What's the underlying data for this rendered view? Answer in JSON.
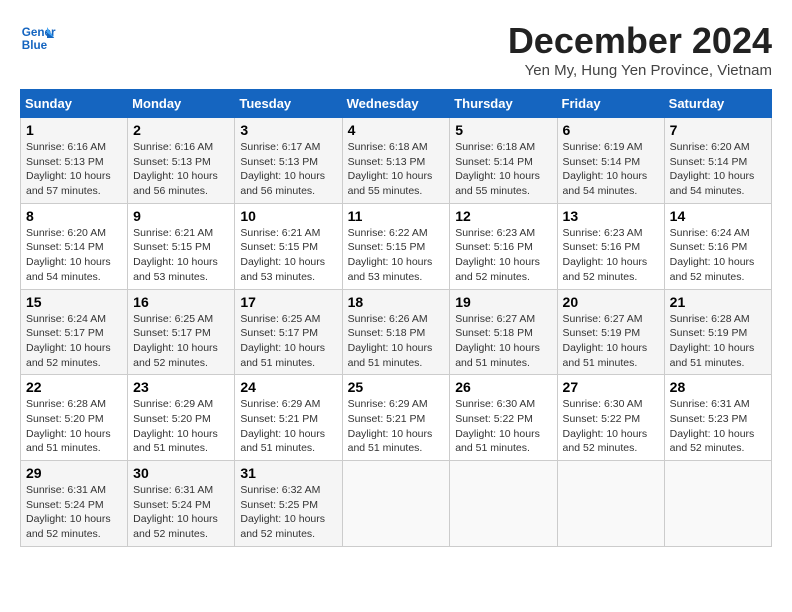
{
  "header": {
    "logo_line1": "General",
    "logo_line2": "Blue",
    "month_title": "December 2024",
    "location": "Yen My, Hung Yen Province, Vietnam"
  },
  "weekdays": [
    "Sunday",
    "Monday",
    "Tuesday",
    "Wednesday",
    "Thursday",
    "Friday",
    "Saturday"
  ],
  "weeks": [
    [
      {
        "day": "1",
        "sunrise": "6:16 AM",
        "sunset": "5:13 PM",
        "daylight": "10 hours and 57 minutes."
      },
      {
        "day": "2",
        "sunrise": "6:16 AM",
        "sunset": "5:13 PM",
        "daylight": "10 hours and 56 minutes."
      },
      {
        "day": "3",
        "sunrise": "6:17 AM",
        "sunset": "5:13 PM",
        "daylight": "10 hours and 56 minutes."
      },
      {
        "day": "4",
        "sunrise": "6:18 AM",
        "sunset": "5:13 PM",
        "daylight": "10 hours and 55 minutes."
      },
      {
        "day": "5",
        "sunrise": "6:18 AM",
        "sunset": "5:14 PM",
        "daylight": "10 hours and 55 minutes."
      },
      {
        "day": "6",
        "sunrise": "6:19 AM",
        "sunset": "5:14 PM",
        "daylight": "10 hours and 54 minutes."
      },
      {
        "day": "7",
        "sunrise": "6:20 AM",
        "sunset": "5:14 PM",
        "daylight": "10 hours and 54 minutes."
      }
    ],
    [
      {
        "day": "8",
        "sunrise": "6:20 AM",
        "sunset": "5:14 PM",
        "daylight": "10 hours and 54 minutes."
      },
      {
        "day": "9",
        "sunrise": "6:21 AM",
        "sunset": "5:15 PM",
        "daylight": "10 hours and 53 minutes."
      },
      {
        "day": "10",
        "sunrise": "6:21 AM",
        "sunset": "5:15 PM",
        "daylight": "10 hours and 53 minutes."
      },
      {
        "day": "11",
        "sunrise": "6:22 AM",
        "sunset": "5:15 PM",
        "daylight": "10 hours and 53 minutes."
      },
      {
        "day": "12",
        "sunrise": "6:23 AM",
        "sunset": "5:16 PM",
        "daylight": "10 hours and 52 minutes."
      },
      {
        "day": "13",
        "sunrise": "6:23 AM",
        "sunset": "5:16 PM",
        "daylight": "10 hours and 52 minutes."
      },
      {
        "day": "14",
        "sunrise": "6:24 AM",
        "sunset": "5:16 PM",
        "daylight": "10 hours and 52 minutes."
      }
    ],
    [
      {
        "day": "15",
        "sunrise": "6:24 AM",
        "sunset": "5:17 PM",
        "daylight": "10 hours and 52 minutes."
      },
      {
        "day": "16",
        "sunrise": "6:25 AM",
        "sunset": "5:17 PM",
        "daylight": "10 hours and 52 minutes."
      },
      {
        "day": "17",
        "sunrise": "6:25 AM",
        "sunset": "5:17 PM",
        "daylight": "10 hours and 51 minutes."
      },
      {
        "day": "18",
        "sunrise": "6:26 AM",
        "sunset": "5:18 PM",
        "daylight": "10 hours and 51 minutes."
      },
      {
        "day": "19",
        "sunrise": "6:27 AM",
        "sunset": "5:18 PM",
        "daylight": "10 hours and 51 minutes."
      },
      {
        "day": "20",
        "sunrise": "6:27 AM",
        "sunset": "5:19 PM",
        "daylight": "10 hours and 51 minutes."
      },
      {
        "day": "21",
        "sunrise": "6:28 AM",
        "sunset": "5:19 PM",
        "daylight": "10 hours and 51 minutes."
      }
    ],
    [
      {
        "day": "22",
        "sunrise": "6:28 AM",
        "sunset": "5:20 PM",
        "daylight": "10 hours and 51 minutes."
      },
      {
        "day": "23",
        "sunrise": "6:29 AM",
        "sunset": "5:20 PM",
        "daylight": "10 hours and 51 minutes."
      },
      {
        "day": "24",
        "sunrise": "6:29 AM",
        "sunset": "5:21 PM",
        "daylight": "10 hours and 51 minutes."
      },
      {
        "day": "25",
        "sunrise": "6:29 AM",
        "sunset": "5:21 PM",
        "daylight": "10 hours and 51 minutes."
      },
      {
        "day": "26",
        "sunrise": "6:30 AM",
        "sunset": "5:22 PM",
        "daylight": "10 hours and 51 minutes."
      },
      {
        "day": "27",
        "sunrise": "6:30 AM",
        "sunset": "5:22 PM",
        "daylight": "10 hours and 52 minutes."
      },
      {
        "day": "28",
        "sunrise": "6:31 AM",
        "sunset": "5:23 PM",
        "daylight": "10 hours and 52 minutes."
      }
    ],
    [
      {
        "day": "29",
        "sunrise": "6:31 AM",
        "sunset": "5:24 PM",
        "daylight": "10 hours and 52 minutes."
      },
      {
        "day": "30",
        "sunrise": "6:31 AM",
        "sunset": "5:24 PM",
        "daylight": "10 hours and 52 minutes."
      },
      {
        "day": "31",
        "sunrise": "6:32 AM",
        "sunset": "5:25 PM",
        "daylight": "10 hours and 52 minutes."
      },
      null,
      null,
      null,
      null
    ]
  ]
}
